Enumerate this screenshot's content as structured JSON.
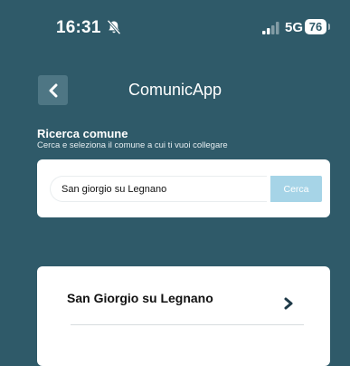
{
  "status_bar": {
    "time": "16:31",
    "network": "5G",
    "battery": "76",
    "icons": [
      "bell-slash-icon",
      "signal-icon"
    ]
  },
  "header": {
    "title": "ComunicApp",
    "back_icon": "chevron-left-icon"
  },
  "search_section": {
    "title": "Ricerca comune",
    "subtitle": "Cerca e seleziona il comune a cui ti vuoi collegare",
    "input_value": "San giorgio su Legnano",
    "button_label": "Cerca"
  },
  "results": {
    "items": [
      {
        "name": "San Giorgio su Legnano",
        "icon": "chevron-right-icon"
      }
    ]
  },
  "colors": {
    "background": "#2f5a69",
    "back_button_bg": "#4e7684",
    "search_button_bg": "#a6d4e7",
    "card_bg": "#ffffff",
    "text_dark": "#111111"
  }
}
